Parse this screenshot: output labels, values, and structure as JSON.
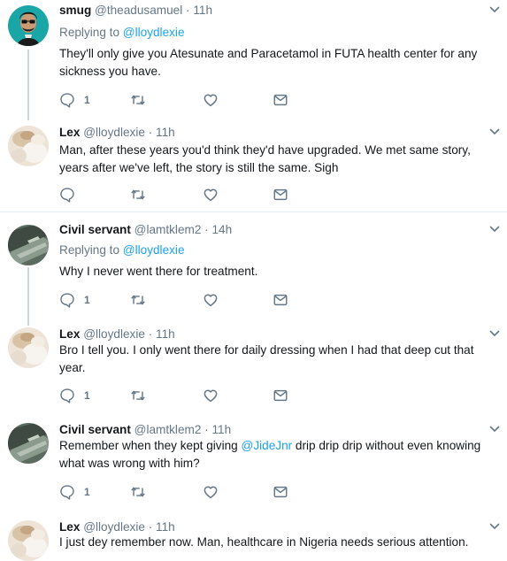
{
  "tweets": [
    {
      "name": "smug",
      "handle": "@theadusamuel",
      "sep": " · ",
      "time": "11h",
      "replying_label": "Replying to",
      "replying_to": "@lloydlexie",
      "text": "They'll only give you Atesunate and Paracetamol in FUTA health center for any sickness you have.",
      "reply_count": "1",
      "avatar": "cartoon-avatar"
    },
    {
      "name": "Lex",
      "handle": "@lloydlexie",
      "sep": " · ",
      "time": "11h",
      "text": "Man, after these years you'd think they'd have upgraded. We met same story, years after we've left, the story is still the same. Sigh",
      "reply_count": "",
      "avatar": "blurred-photo-avatar"
    },
    {
      "name": "Civil servant",
      "handle": "@lamtklem2",
      "sep": " · ",
      "time": "14h",
      "replying_label": "Replying to",
      "replying_to": "@lloydlexie",
      "text": "Why I never went there for treatment.",
      "reply_count": "1",
      "avatar": "car-seat-photo-avatar"
    },
    {
      "name": "Lex",
      "handle": "@lloydlexie",
      "sep": " · ",
      "time": "11h",
      "text": "Bro I tell you. I only went there for daily dressing when I had that deep cut that year.",
      "reply_count": "1",
      "avatar": "blurred-photo-avatar"
    },
    {
      "name": "Civil servant",
      "handle": "@lamtklem2",
      "sep": " · ",
      "time": "11h",
      "text_before": "Remember when they kept giving ",
      "text_mention": "@JideJnr",
      "text_after": " drip drip drip without even knowing what was wrong with him?",
      "reply_count": "1",
      "avatar": "car-seat-photo-avatar"
    },
    {
      "name": "Lex",
      "handle": "@lloydlexie",
      "sep": " · ",
      "time": "11h",
      "text": "I just dey remember now. Man, healthcare in Nigeria needs serious attention.",
      "avatar": "blurred-photo-avatar"
    }
  ],
  "colors": {
    "link": "#1da1f2",
    "secondary_text": "#657786",
    "divider": "#e6ecf0",
    "thread_line": "#ccd6dd"
  },
  "icons": {
    "reply": "speech-bubble-icon",
    "retweet": "retweet-arrows-icon",
    "like": "heart-icon",
    "dm": "envelope-icon",
    "menu": "chevron-down-icon"
  }
}
